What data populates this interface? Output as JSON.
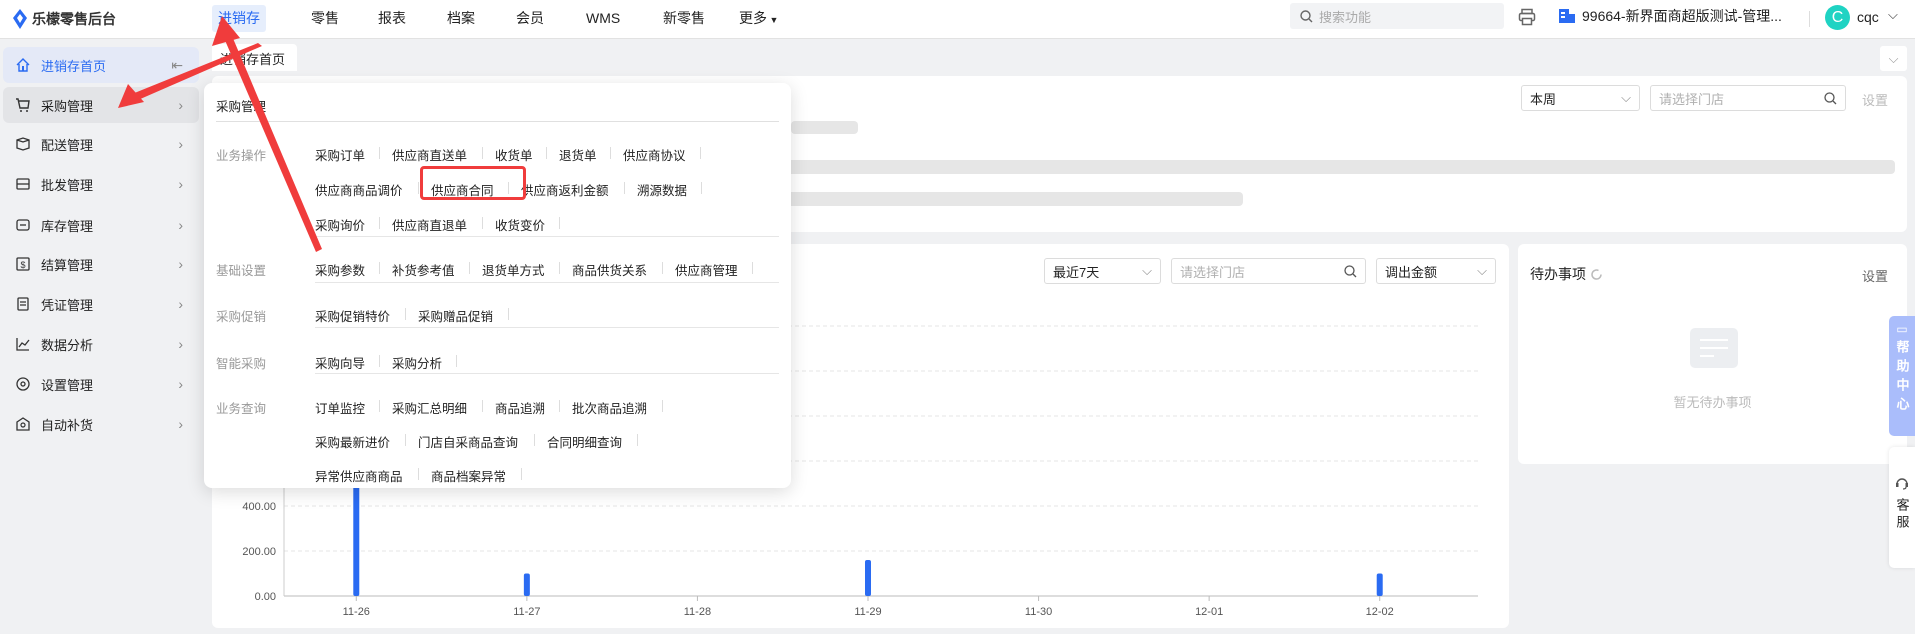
{
  "app": {
    "logo_text": "乐檬零售后台"
  },
  "nav": {
    "items": [
      "进销存",
      "零售",
      "报表",
      "档案",
      "会员",
      "WMS",
      "新零售",
      "更多"
    ],
    "active": "进销存"
  },
  "search": {
    "placeholder": "搜索功能"
  },
  "store": {
    "name": "99664-新界面商超版测试-管理..."
  },
  "user": {
    "initial": "C",
    "name": "cqc"
  },
  "sidebar": {
    "items": [
      {
        "label": "进销存首页",
        "icon": "home-icon"
      },
      {
        "label": "采购管理",
        "icon": "cart-icon"
      },
      {
        "label": "配送管理",
        "icon": "delivery-icon"
      },
      {
        "label": "批发管理",
        "icon": "wholesale-icon"
      },
      {
        "label": "库存管理",
        "icon": "inventory-icon"
      },
      {
        "label": "结算管理",
        "icon": "dollar-icon"
      },
      {
        "label": "凭证管理",
        "icon": "voucher-icon"
      },
      {
        "label": "数据分析",
        "icon": "chart-icon"
      },
      {
        "label": "设置管理",
        "icon": "settings-icon"
      },
      {
        "label": "自动补货",
        "icon": "replenish-icon"
      }
    ]
  },
  "tabs": {
    "active": "进销存首页"
  },
  "top_card": {
    "period": "本周",
    "store_placeholder": "请选择门店",
    "settings": "设置"
  },
  "menu": {
    "title": "采购管理",
    "groups": [
      {
        "label": "业务操作",
        "rows": [
          [
            "采购订单",
            "供应商直送单",
            "收货单",
            "退货单",
            "供应商协议"
          ],
          [
            "供应商商品调价",
            "供应商合同",
            "供应商返利金额",
            "溯源数据"
          ],
          [
            "采购询价",
            "供应商直退单",
            "收货变价"
          ]
        ]
      },
      {
        "label": "基础设置",
        "rows": [
          [
            "采购参数",
            "补货参考值",
            "退货单方式",
            "商品供货关系",
            "供应商管理"
          ]
        ]
      },
      {
        "label": "采购促销",
        "rows": [
          [
            "采购促销特价",
            "采购赠品促销"
          ]
        ]
      },
      {
        "label": "智能采购",
        "rows": [
          [
            "采购向导",
            "采购分析"
          ]
        ]
      },
      {
        "label": "业务查询",
        "rows": [
          [
            "订单监控",
            "采购汇总明细",
            "商品追溯",
            "批次商品追溯"
          ],
          [
            "采购最新进价",
            "门店自采商品查询",
            "合同明细查询"
          ],
          [
            "异常供应商商品",
            "商品档案异常"
          ]
        ]
      }
    ],
    "highlighted": "供应商合同"
  },
  "chart_card": {
    "period": "最近7天",
    "store_placeholder": "请选择门店",
    "metric": "调出金额"
  },
  "chart_data": {
    "type": "bar",
    "categories": [
      "11-26",
      "11-27",
      "11-28",
      "11-29",
      "11-30",
      "12-01",
      "12-02"
    ],
    "values": [
      600,
      100,
      0,
      160,
      0,
      0,
      100
    ],
    "ylim": [
      0,
      1200
    ],
    "yticks": [
      "0.00",
      "200.00",
      "400.00"
    ],
    "ytick_values": [
      0,
      200,
      400,
      600,
      800,
      1000,
      1200
    ],
    "color": "#2a6bf2",
    "grid": true
  },
  "todo": {
    "title": "待办事项",
    "settings": "设置",
    "empty": "暂无待办事项"
  },
  "float": {
    "help": "帮助中心",
    "service": "客服"
  },
  "colors": {
    "accent": "#2a6bf2",
    "annotation": "#f03c3c"
  }
}
